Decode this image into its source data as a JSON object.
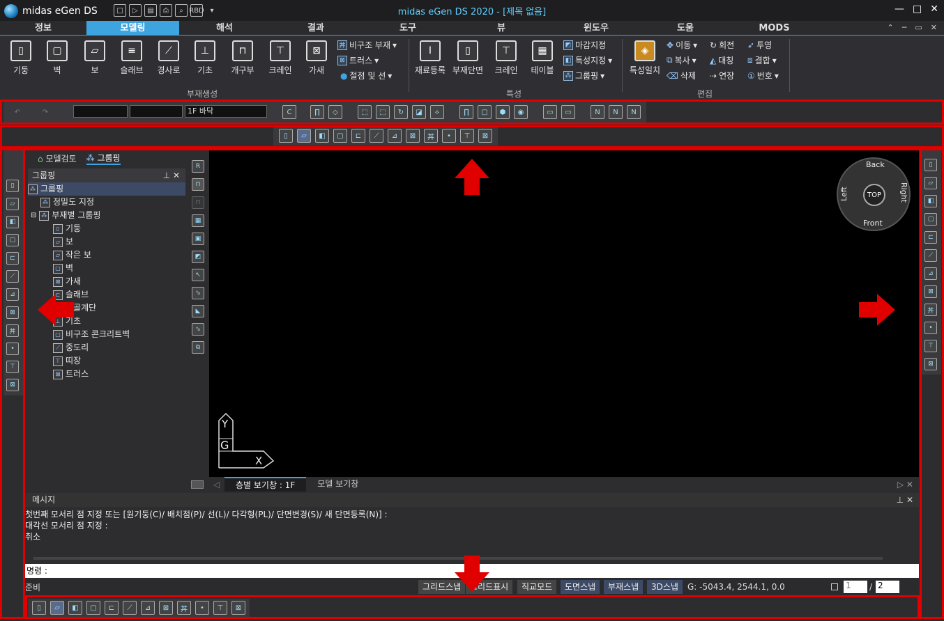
{
  "app": {
    "logo_text": "midas eGen DS",
    "title": "midas eGen DS 2020 - [제목 없음]",
    "window_controls": [
      "—",
      "□",
      "✕"
    ],
    "quick_access": [
      "□",
      "▷",
      "▤",
      "⎙",
      "⌕",
      "RBD",
      "▾"
    ]
  },
  "menu": {
    "tabs": [
      "정보",
      "모델링",
      "해석",
      "결과",
      "도구",
      "뷰",
      "윈도우",
      "도움",
      "MODS"
    ],
    "active": "모델링",
    "right": [
      "⌃",
      "─",
      "▭",
      "✕"
    ]
  },
  "ribbon": {
    "large_buttons": [
      "기둥",
      "벽",
      "보",
      "슬래브",
      "경사로",
      "기초",
      "개구부",
      "크레인",
      "가새",
      "재료등록",
      "부재단면",
      "크레인",
      "테이블",
      "특성일치"
    ],
    "small": {
      "bigujo": "비구조 부재",
      "truss": "트러스",
      "node_line": "절점 및 선",
      "finish": "마감지정",
      "prop_set": "특성지정",
      "grouping": "그룹핑",
      "move": "이동",
      "rotate": "회전",
      "copy": "복사",
      "mirror": "대칭",
      "delete": "삭제",
      "extend": "연장",
      "project": "투영",
      "join": "결합",
      "number": "번호"
    },
    "groups": [
      "부재생성",
      "특성",
      "편집"
    ]
  },
  "toolbar": {
    "floor_combo": "1F 바닥"
  },
  "panel": {
    "tabs": [
      "모델검토",
      "그룹핑"
    ],
    "header": "그룹핑",
    "tree": [
      "그룹핑",
      "정밀도 지정",
      "부재별 그룹핑",
      "기둥",
      "보",
      "작은 보",
      "벽",
      "가새",
      "슬래브",
      "철골계단",
      "기초",
      "비구조 콘크리트벽",
      "중도리",
      "띠장",
      "트러스"
    ]
  },
  "viewcube": {
    "back": "Back",
    "front": "Front",
    "left": "Left",
    "right": "Right",
    "top": "TOP"
  },
  "axis": {
    "y": "Y",
    "g": "G",
    "x": "X"
  },
  "viewtabs": [
    "층별 보기창 : 1F",
    "모델 보기창"
  ],
  "messages": {
    "title": "메시지",
    "lines": [
      "첫번째 모서리 점 지정 또는 [원기둥(C)/ 배치점(P)/ 선(L)/ 다각형(PL)/ 단면변경(S)/ 새 단면등록(N)] :",
      "대각선 모서리 점 지정 :",
      "취소"
    ]
  },
  "command": {
    "label": "명령 :"
  },
  "status": {
    "ready": "준비",
    "snaps": [
      "그리드스냅",
      "그리드표시",
      "직교모드",
      "도면스냅",
      "부재스냅",
      "3D스냅"
    ],
    "coords": "G: -5043.4, 2544.1, 0.0",
    "page_current": "1",
    "page_total": "2"
  },
  "colors": {
    "accent": "#3ea4e0",
    "highlight": "#e00000"
  }
}
